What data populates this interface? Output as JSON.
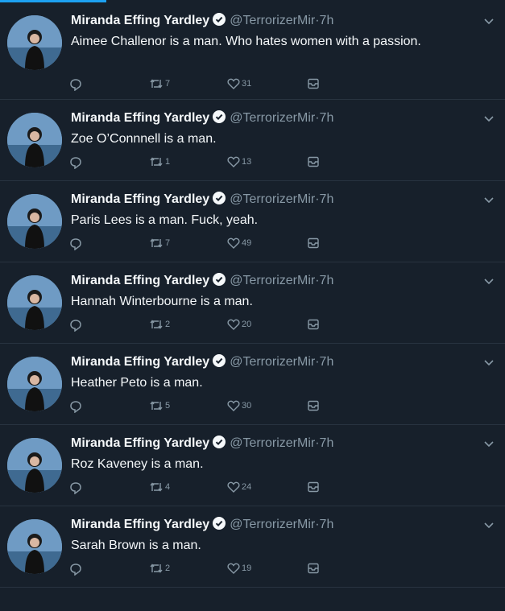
{
  "author": {
    "name": "Miranda Effing Yardley",
    "handle": "@TerrorizerMir",
    "separator": "·",
    "time": "7h"
  },
  "tweets": [
    {
      "text": "Aimee Challenor is a man. Who hates women with a passion.",
      "retweets": "7",
      "likes": "31"
    },
    {
      "text": "Zoe O’Connnell is a man.",
      "retweets": "1",
      "likes": "13"
    },
    {
      "text": "Paris Lees is a man. Fuck, yeah.",
      "retweets": "7",
      "likes": "49"
    },
    {
      "text": "Hannah Winterbourne is a man.",
      "retweets": "2",
      "likes": "20"
    },
    {
      "text": "Heather Peto is a man.",
      "retweets": "5",
      "likes": "30"
    },
    {
      "text": "Roz Kaveney is a man.",
      "retweets": "4",
      "likes": "24"
    },
    {
      "text": "Sarah Brown is a man.",
      "retweets": "2",
      "likes": "19"
    }
  ],
  "icons": {
    "reply": "reply-icon",
    "retweet": "retweet-icon",
    "like": "heart-icon",
    "dm": "envelope-icon",
    "menu": "chevron-down-icon",
    "verified": "verified-badge-icon"
  },
  "colors": {
    "background": "#17202b",
    "text": "#f5f8fa",
    "muted": "#8899a6",
    "accent": "#1da1f2",
    "divider": "#283340"
  }
}
